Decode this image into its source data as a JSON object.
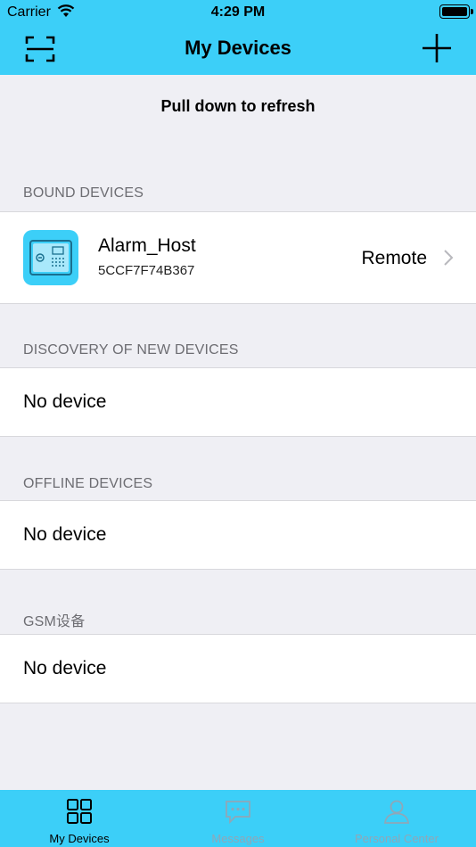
{
  "status_bar": {
    "carrier": "Carrier",
    "time": "4:29 PM"
  },
  "nav": {
    "title": "My Devices",
    "left_icon": "scan-icon",
    "right_icon": "plus-icon"
  },
  "refresh_hint": "Pull down to refresh",
  "sections": {
    "bound": {
      "header": "BOUND DEVICES",
      "device": {
        "name": "Alarm_Host",
        "id": "5CCF7F74B367",
        "mode": "Remote",
        "icon": "alarm-host-icon"
      }
    },
    "discovery": {
      "header": "DISCOVERY OF NEW DEVICES",
      "empty_text": "No device"
    },
    "offline": {
      "header": "OFFLINE DEVICES",
      "empty_text": "No device"
    },
    "gsm": {
      "header": "GSM设备",
      "empty_text": "No device"
    }
  },
  "tabs": [
    {
      "label": "My Devices",
      "icon": "devices-grid-icon",
      "active": true
    },
    {
      "label": "Messages",
      "icon": "message-icon",
      "active": false
    },
    {
      "label": "Personal Center",
      "icon": "person-icon",
      "active": false
    }
  ],
  "colors": {
    "brand": "#3ccff8",
    "background": "#efeff4",
    "inactive_tab": "#8fa7b8"
  }
}
